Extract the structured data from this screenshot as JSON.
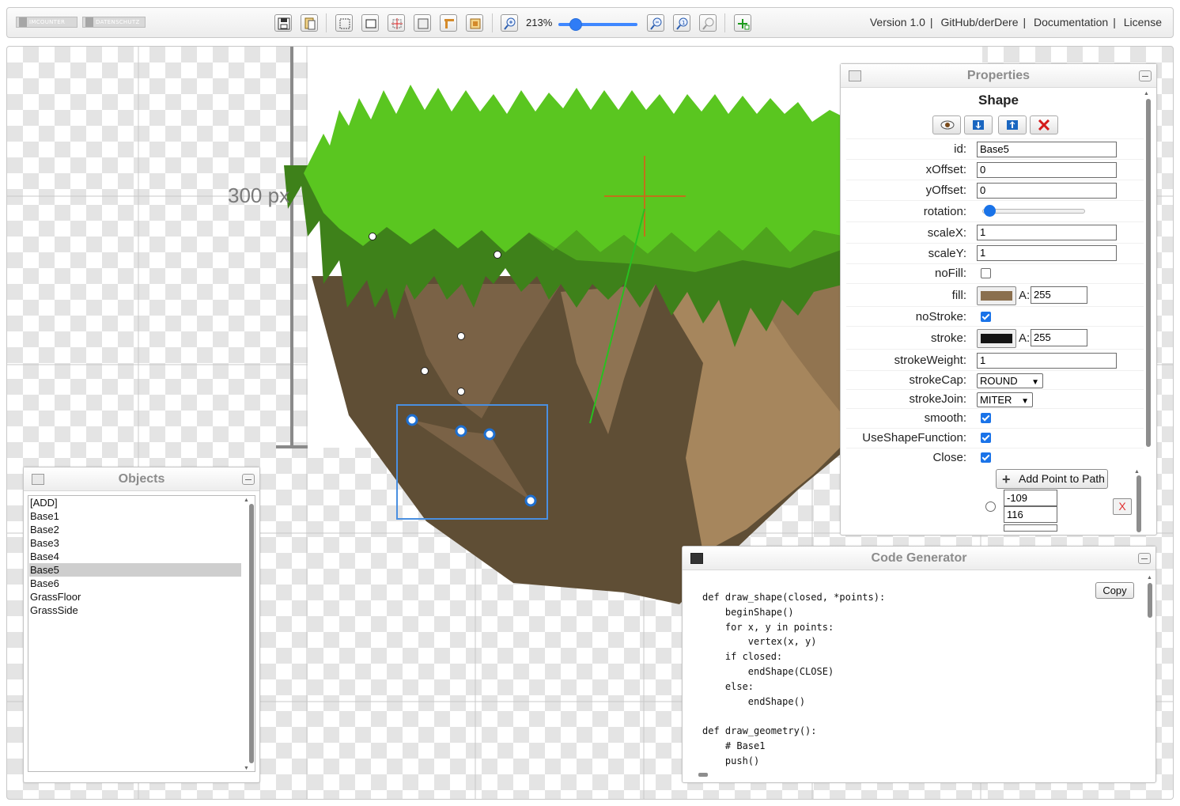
{
  "toolbar": {
    "badges": [
      "IMCOUNTER",
      "DATENSCHUTZ"
    ],
    "zoom_text": "213%",
    "zoom_level": 0.22,
    "links": [
      "Version 1.0",
      "GitHub/derDere",
      "Documentation",
      "License"
    ],
    "icons": [
      "save-icon",
      "load-icon",
      "select-icon",
      "rectangle-icon",
      "center-icon",
      "frame-icon",
      "align-icon",
      "layers-icon",
      "zoom-in-icon",
      "zoom-out-icon",
      "zoom-reset-icon",
      "zoom-fit-icon",
      "add-shape-icon"
    ]
  },
  "canvas": {
    "size_label": "300 px",
    "colors": {
      "grass_light": "#5ac620",
      "grass_dark": "#3e811a",
      "dirt_dark": "#5f4e35",
      "dirt_mid": "#7a6246",
      "dirt_light": "#a6865d",
      "handle": "#1e6fd0",
      "selection": "#4a8fe0"
    }
  },
  "objects": {
    "title": "Objects",
    "items": [
      "[ADD]",
      "Base1",
      "Base2",
      "Base3",
      "Base4",
      "Base5",
      "Base6",
      "GrassFloor",
      "GrassSide"
    ],
    "selected": "Base5"
  },
  "properties": {
    "title": "Properties",
    "heading": "Shape",
    "buttons": [
      "eye-icon",
      "move-down-icon",
      "move-up-icon",
      "delete-icon"
    ],
    "id_label": "id:",
    "id": "Base5",
    "xoffset_label": "xOffset:",
    "xoffset": "0",
    "yoffset_label": "yOffset:",
    "yoffset": "0",
    "rotation_label": "rotation:",
    "rotation": 0,
    "scalex_label": "scaleX:",
    "scalex": "1",
    "scaley_label": "scaleY:",
    "scaley": "1",
    "nofill_label": "noFill:",
    "nofill": false,
    "fill_label": "fill:",
    "fill_color": "#8a6f4e",
    "fill_alpha": "255",
    "nostroke_label": "noStroke:",
    "nostroke": true,
    "stroke_label": "stroke:",
    "stroke_color": "#141414",
    "stroke_alpha": "255",
    "alpha_prefix": "A:",
    "strokeweight_label": "strokeWeight:",
    "strokeweight": "1",
    "strokecap_label": "strokeCap:",
    "strokecap": "ROUND",
    "strokejoin_label": "strokeJoin:",
    "strokejoin": "MITER",
    "smooth_label": "smooth:",
    "smooth": true,
    "useshapefunction_label": "UseShapeFunction:",
    "useshapefunction": true,
    "close_label": "Close:",
    "close": true,
    "add_point_label": "Add Point to Path",
    "point_x": "-109",
    "point_y": "116",
    "delete_point_label": "X"
  },
  "code_generator": {
    "title": "Code Generator",
    "copy_label": "Copy",
    "code": "def draw_shape(closed, *points):\n    beginShape()\n    for x, y in points:\n        vertex(x, y)\n    if closed:\n        endShape(CLOSE)\n    else:\n        endShape()\n\ndef draw_geometry():\n    # Base1\n    push()"
  }
}
